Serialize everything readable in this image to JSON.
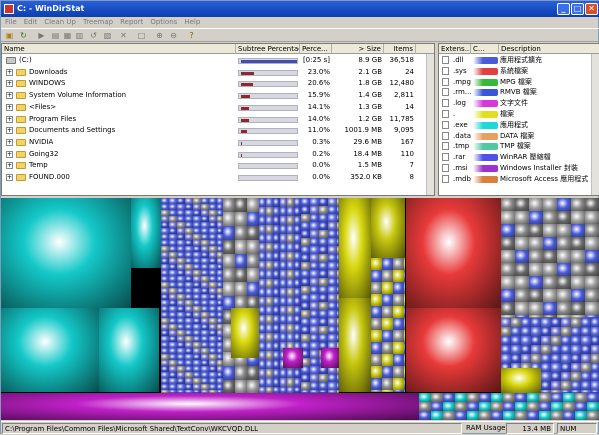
{
  "window": {
    "title": "C: - WinDirStat",
    "min": "_",
    "max": "□",
    "close": "✕"
  },
  "menu": [
    "File",
    "Edit",
    "Clean Up",
    "Treemap",
    "Report",
    "Options",
    "Help"
  ],
  "toolbar_icons": [
    "open-icon",
    "refresh-icon",
    "play-icon",
    "open-explorer-icon",
    "open-folder-icon",
    "copy-path-icon",
    "refresh-selected-icon",
    "properties-icon",
    "delete-icon",
    "new-item-icon",
    "zoom-in-icon",
    "zoom-out-icon",
    "help-icon"
  ],
  "dir": {
    "columns": {
      "name": "Name",
      "subtree": "Subtree Percentage",
      "percent": "Perce...",
      "size": "> Size",
      "items": "Items"
    },
    "root": {
      "name": "(C:)",
      "pct": "[0:25 s]",
      "size": "8.9 GB",
      "items": "36,518",
      "fill": 100
    },
    "rows": [
      {
        "name": "Downloads",
        "pct": "23.0%",
        "size": "2.1 GB",
        "items": "24",
        "fill": 23
      },
      {
        "name": "WINDOWS",
        "pct": "20.6%",
        "size": "1.8 GB",
        "items": "12,480",
        "fill": 20.6
      },
      {
        "name": "System Volume Information",
        "pct": "15.9%",
        "size": "1.4 GB",
        "items": "2,811",
        "fill": 15.9
      },
      {
        "name": "<Files>",
        "pct": "14.1%",
        "size": "1.3 GB",
        "items": "14",
        "fill": 14.1
      },
      {
        "name": "Program Files",
        "pct": "14.0%",
        "size": "1.2 GB",
        "items": "11,785",
        "fill": 14
      },
      {
        "name": "Documents and Settings",
        "pct": "11.0%",
        "size": "1001.9 MB",
        "items": "9,095",
        "fill": 11
      },
      {
        "name": "NVIDIA",
        "pct": "0.3%",
        "size": "29.6 MB",
        "items": "167",
        "fill": 0.3
      },
      {
        "name": "Going32",
        "pct": "0.2%",
        "size": "18.4 MB",
        "items": "110",
        "fill": 0.2
      },
      {
        "name": "Temp",
        "pct": "0.0%",
        "size": "1.5 MB",
        "items": "7",
        "fill": 0
      },
      {
        "name": "FOUND.000",
        "pct": "0.0%",
        "size": "352.0 KB",
        "items": "8",
        "fill": 0
      }
    ]
  },
  "ext": {
    "columns": {
      "ext": "Extens...",
      "color": "C...",
      "desc": "Description"
    },
    "rows": [
      {
        "ext": ".dll",
        "color": "#4a5bd8",
        "desc": "應用程式擴充"
      },
      {
        "ext": ".sys",
        "color": "#e04040",
        "desc": "系統檔案"
      },
      {
        "ext": ".mpg",
        "color": "#38b838",
        "desc": "MPG 檔案"
      },
      {
        "ext": ".rm...",
        "color": "#3858d8",
        "desc": "RMVB 檔案"
      },
      {
        "ext": ".log",
        "color": "#d838d8",
        "desc": "文字文件"
      },
      {
        "ext": ".",
        "color": "#e0e020",
        "desc": "檔案"
      },
      {
        "ext": ".exe",
        "color": "#20d8d8",
        "desc": "應用程式"
      },
      {
        "ext": ".data",
        "color": "#e8a060",
        "desc": "DATA 檔案"
      },
      {
        "ext": ".tmp",
        "color": "#50c8a0",
        "desc": "TMP 檔案"
      },
      {
        "ext": ".rar",
        "color": "#5050e8",
        "desc": "WinRAR 壓縮檔"
      },
      {
        "ext": ".msi",
        "color": "#a030d0",
        "desc": "Windows Installer 封裝"
      },
      {
        "ext": ".mdb",
        "color": "#d88040",
        "desc": "Microsoft Access 應用程式"
      }
    ]
  },
  "status": {
    "path": "C:\\Program Files\\Common Files\\Microsoft Shared\\TextConv\\WKCVQD.DLL",
    "ram_label": "RAM Usage:",
    "ram_value": "13.4 MB",
    "num": "NUM"
  }
}
